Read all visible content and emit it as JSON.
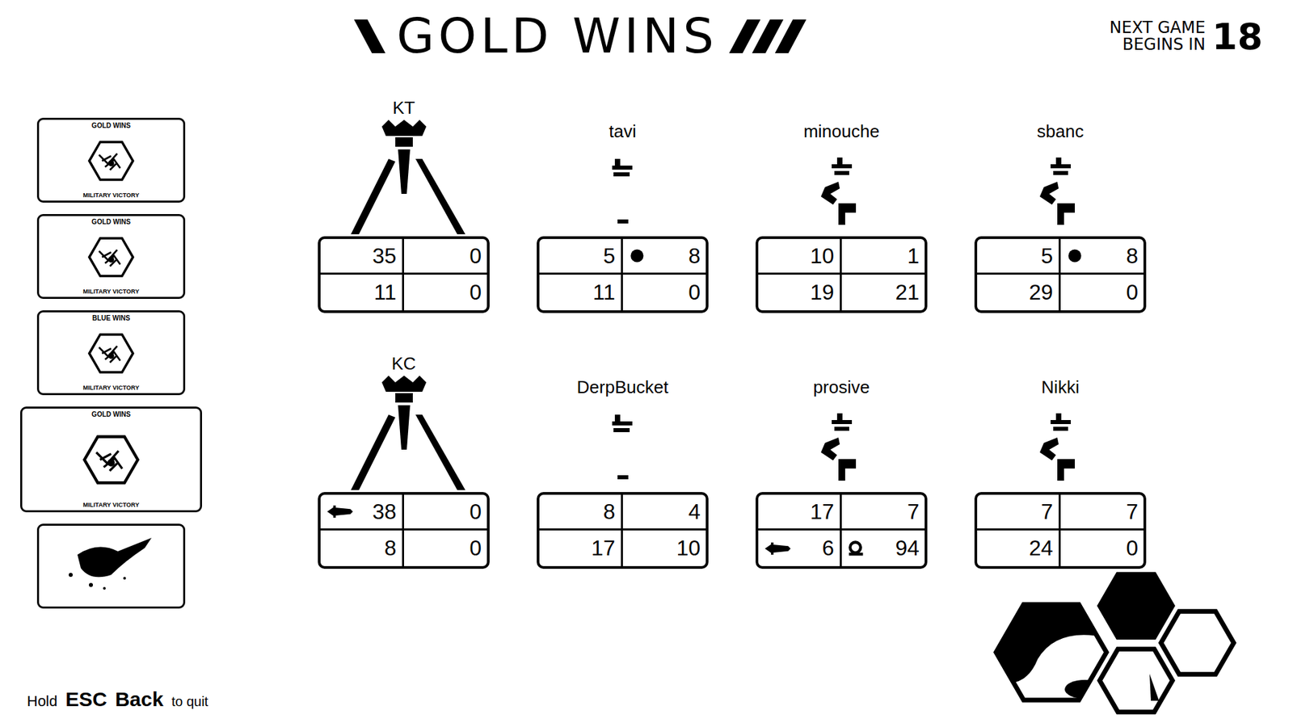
{
  "header": {
    "title": "GOLD WINS",
    "countdown_label": [
      "NEXT GAME",
      "BEGINS IN"
    ],
    "countdown": "18"
  },
  "history": [
    {
      "kind": "result",
      "title": "GOLD WINS",
      "subtitle": "MILITARY VICTORY",
      "selected": false
    },
    {
      "kind": "result",
      "title": "GOLD WINS",
      "subtitle": "MILITARY VICTORY",
      "selected": false
    },
    {
      "kind": "result",
      "title": "BLUE WINS",
      "subtitle": "MILITARY VICTORY",
      "selected": false
    },
    {
      "kind": "result",
      "title": "GOLD WINS",
      "subtitle": "MILITARY VICTORY",
      "selected": true
    },
    {
      "kind": "map",
      "title": "",
      "subtitle": "",
      "selected": false
    }
  ],
  "players": [
    {
      "name": "KT",
      "kind": "queen",
      "stats": [
        {
          "value": "35",
          "kind": "plain"
        },
        {
          "value": "0",
          "kind": "plain"
        },
        {
          "value": "11",
          "kind": "plain"
        },
        {
          "value": "0",
          "kind": "plain"
        }
      ]
    },
    {
      "name": "tavi",
      "kind": "drone",
      "stats": [
        {
          "value": "5",
          "kind": "plain"
        },
        {
          "value": "8",
          "kind": "berry"
        },
        {
          "value": "11",
          "kind": "plain"
        },
        {
          "value": "0",
          "kind": "plain"
        }
      ]
    },
    {
      "name": "minouche",
      "kind": "warrior",
      "stats": [
        {
          "value": "10",
          "kind": "plain"
        },
        {
          "value": "1",
          "kind": "plain"
        },
        {
          "value": "19",
          "kind": "plain"
        },
        {
          "value": "21",
          "kind": "plain"
        }
      ]
    },
    {
      "name": "sbanc",
      "kind": "warrior",
      "stats": [
        {
          "value": "5",
          "kind": "plain"
        },
        {
          "value": "8",
          "kind": "berry"
        },
        {
          "value": "29",
          "kind": "plain"
        },
        {
          "value": "0",
          "kind": "plain"
        }
      ]
    },
    {
      "name": "KC",
      "kind": "queen",
      "stats": [
        {
          "value": "38",
          "kind": "sword"
        },
        {
          "value": "0",
          "kind": "plain"
        },
        {
          "value": "8",
          "kind": "plain"
        },
        {
          "value": "0",
          "kind": "plain"
        }
      ]
    },
    {
      "name": "DerpBucket",
      "kind": "drone",
      "stats": [
        {
          "value": "8",
          "kind": "plain"
        },
        {
          "value": "4",
          "kind": "plain"
        },
        {
          "value": "17",
          "kind": "plain"
        },
        {
          "value": "10",
          "kind": "plain"
        }
      ]
    },
    {
      "name": "prosive",
      "kind": "warrior",
      "stats": [
        {
          "value": "17",
          "kind": "plain"
        },
        {
          "value": "7",
          "kind": "plain"
        },
        {
          "value": "6",
          "kind": "sword"
        },
        {
          "value": "94",
          "kind": "snail"
        }
      ]
    },
    {
      "name": "Nikki",
      "kind": "warrior",
      "stats": [
        {
          "value": "7",
          "kind": "plain"
        },
        {
          "value": "7",
          "kind": "plain"
        },
        {
          "value": "24",
          "kind": "plain"
        },
        {
          "value": "0",
          "kind": "plain"
        }
      ]
    }
  ],
  "hint": {
    "prefix": "Hold",
    "key": "ESC",
    "action": "Back",
    "suffix": "to quit"
  },
  "map_hexes": [
    {
      "kind": "map"
    },
    {
      "kind": "filled"
    },
    {
      "kind": "empty"
    },
    {
      "kind": "partial"
    }
  ]
}
